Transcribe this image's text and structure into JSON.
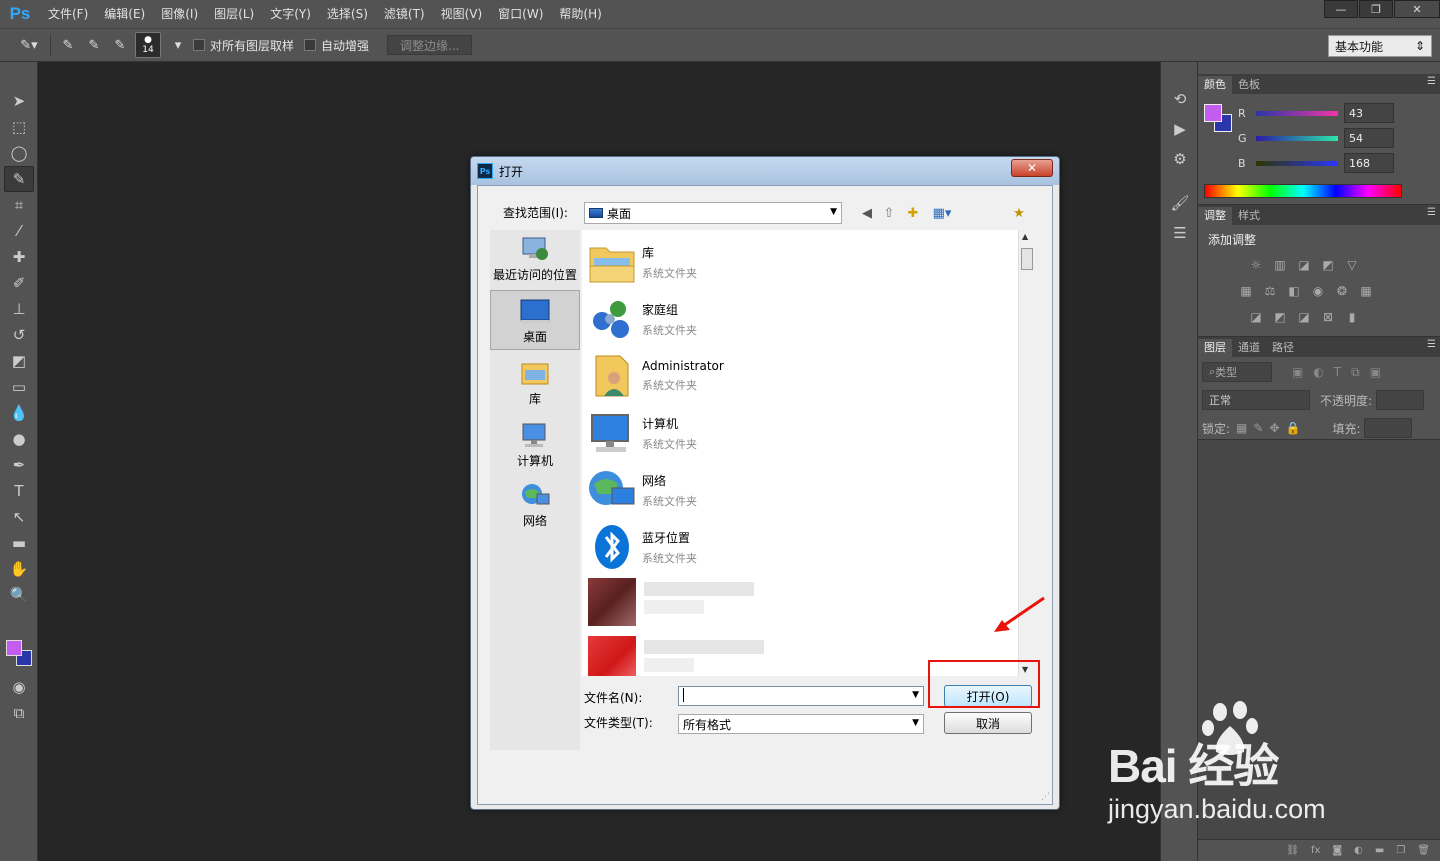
{
  "menubar": {
    "logo": "Ps",
    "items": [
      "文件(F)",
      "编辑(E)",
      "图像(I)",
      "图层(L)",
      "文字(Y)",
      "选择(S)",
      "滤镜(T)",
      "视图(V)",
      "窗口(W)",
      "帮助(H)"
    ],
    "window_controls": [
      "—",
      "❐",
      "✕"
    ]
  },
  "optionsbar": {
    "brush_size": "14",
    "sample_all_layers": "对所有图层取样",
    "auto_enhance": "自动增强",
    "refine_edge": "调整边缘...",
    "workspace": "基本功能"
  },
  "colors": {
    "foreground": "#c45cf0",
    "background": "#2b36a8",
    "highlight": "#e8140c"
  },
  "color_panel": {
    "tabs": [
      "颜色",
      "色板"
    ],
    "channels": [
      {
        "label": "R",
        "value": "43"
      },
      {
        "label": "G",
        "value": "54"
      },
      {
        "label": "B",
        "value": "168"
      }
    ]
  },
  "adjust_panel": {
    "tabs": [
      "调整",
      "样式"
    ],
    "title": "添加调整"
  },
  "layers_panel": {
    "tabs": [
      "图层",
      "通道",
      "路径"
    ],
    "filter": "类型",
    "blend_mode": "正常",
    "opacity_label": "不透明度:",
    "lock_label": "锁定:",
    "fill_label": "填充:"
  },
  "dialog": {
    "title": "打开",
    "lookin_label": "查找范围(I):",
    "lookin_value": "桌面",
    "places": [
      {
        "label": "最近访问的位置",
        "icon": "recent-places-icon"
      },
      {
        "label": "桌面",
        "icon": "desktop-icon"
      },
      {
        "label": "库",
        "icon": "library-icon"
      },
      {
        "label": "计算机",
        "icon": "computer-icon"
      },
      {
        "label": "网络",
        "icon": "network-icon"
      }
    ],
    "files": [
      {
        "name": "库",
        "type": "系统文件夹",
        "icon": "library-folder-icon"
      },
      {
        "name": "家庭组",
        "type": "系统文件夹",
        "icon": "homegroup-icon"
      },
      {
        "name": "Administrator",
        "type": "系统文件夹",
        "icon": "user-folder-icon"
      },
      {
        "name": "计算机",
        "type": "系统文件夹",
        "icon": "computer-icon"
      },
      {
        "name": "网络",
        "type": "系统文件夹",
        "icon": "network-icon"
      },
      {
        "name": "蓝牙位置",
        "type": "系统文件夹",
        "icon": "bluetooth-icon"
      }
    ],
    "filename_label": "文件名(N):",
    "filename_value": "",
    "filetype_label": "文件类型(T):",
    "filetype_value": "所有格式",
    "open_button": "打开(O)",
    "cancel_button": "取消"
  },
  "watermark": {
    "brand": "Bai 经验",
    "url": "jingyan.baidu.com"
  }
}
